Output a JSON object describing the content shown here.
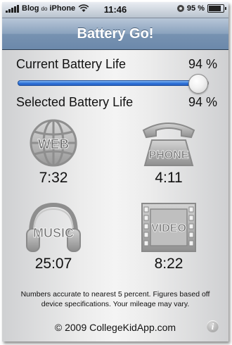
{
  "status_bar": {
    "carrier": "Blog",
    "carrier_small": "do",
    "carrier_suffix": "iPhone",
    "time": "11:46",
    "battery_text": "95 %",
    "battery_level": 0.95,
    "icons": [
      "signal-bars-icon",
      "wifi-icon",
      "rotation-lock-icon",
      "battery-icon"
    ]
  },
  "nav": {
    "title": "Battery Go!"
  },
  "current": {
    "label": "Current Battery Life",
    "value": "94 %"
  },
  "slider": {
    "level": 0.94
  },
  "selected": {
    "label": "Selected Battery Life",
    "value": "94 %"
  },
  "tiles": [
    {
      "name": "WEB",
      "icon": "globe-icon",
      "time": "7:32"
    },
    {
      "name": "PHONE",
      "icon": "telephone-icon",
      "time": "4:11"
    },
    {
      "name": "MUSIC",
      "icon": "headphones-icon",
      "time": "25:07"
    },
    {
      "name": "VIDEO",
      "icon": "film-icon",
      "time": "8:22"
    }
  ],
  "footer": {
    "note": "Numbers accurate to nearest 5 percent. Figures based off device specifications. Your mileage may vary.",
    "copyright": "© 2009 CollegeKidApp.com",
    "info_glyph": "i"
  },
  "colors": {
    "accent": "#2a6fd6",
    "navbar": "#7792b1"
  }
}
